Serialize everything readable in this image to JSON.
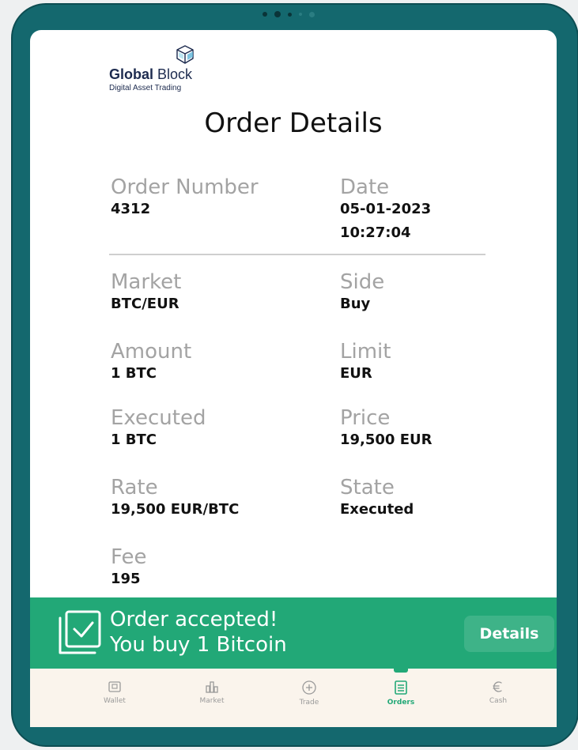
{
  "brand": {
    "name_bold": "Global",
    "name_rest": "Block",
    "tagline": "Digital Asset Trading"
  },
  "page": {
    "title": "Order Details"
  },
  "order": {
    "order_number": {
      "label": "Order Number",
      "value": "4312"
    },
    "date": {
      "label": "Date",
      "value": "05-01-2023",
      "time": "10:27:04"
    },
    "market": {
      "label": "Market",
      "value": "BTC/EUR"
    },
    "side": {
      "label": "Side",
      "value": "Buy"
    },
    "amount": {
      "label": "Amount",
      "value": "1 BTC"
    },
    "limit": {
      "label": "Limit",
      "value": "EUR"
    },
    "executed": {
      "label": "Executed",
      "value": "1 BTC"
    },
    "price": {
      "label": "Price",
      "value": "19,500 EUR"
    },
    "rate": {
      "label": "Rate",
      "value": "19,500 EUR/BTC"
    },
    "state": {
      "label": "State",
      "value": "Executed"
    },
    "fee": {
      "label": "Fee",
      "value": "195"
    }
  },
  "toast": {
    "line1": "Order accepted!",
    "line2": "You buy 1 Bitcoin",
    "button_label": "Details",
    "icon": "checkbox-stack-icon"
  },
  "nav": {
    "items": [
      {
        "label": "Wallet",
        "icon": "wallet-icon"
      },
      {
        "label": "Market",
        "icon": "market-icon"
      },
      {
        "label": "Trade",
        "icon": "plus-circle-icon"
      },
      {
        "label": "Orders",
        "icon": "orders-icon",
        "active": true
      },
      {
        "label": "Cash",
        "icon": "euro-icon"
      }
    ]
  },
  "colors": {
    "device_frame": "#14686e",
    "accent_green": "#22a877",
    "label_gray": "#a3a3a3",
    "nav_background": "#faf4ec",
    "brand_navy": "#1d2b4f"
  }
}
